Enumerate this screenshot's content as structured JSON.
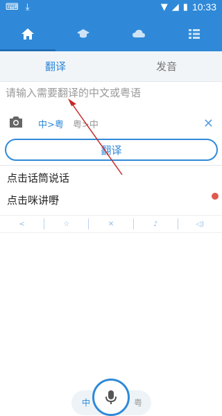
{
  "status_bar": {
    "time": "10:33",
    "icons": [
      "keyboard-icon",
      "download-icon",
      "wifi-icon",
      "signal-icon",
      "battery-icon"
    ]
  },
  "top_nav": {
    "items": [
      {
        "icon": "home-icon",
        "active": true
      },
      {
        "icon": "graduation-cap-icon",
        "active": false
      },
      {
        "icon": "cloud-icon",
        "active": false
      },
      {
        "icon": "grid-list-icon",
        "active": false
      }
    ]
  },
  "tabs": {
    "translate": "翻译",
    "pronounce": "发音"
  },
  "input": {
    "placeholder": "请输入需要翻译的中文或粤语"
  },
  "controls": {
    "camera_icon": "camera-icon",
    "zh_to_yue": "中>粤",
    "yue_to_zh": "粤>中",
    "clear_icon": "close-icon"
  },
  "translate_button": "翻译",
  "output": {
    "line1": "点击话筒说话",
    "line2": "点击咪讲嘢"
  },
  "actions": [
    {
      "icon": "share-icon",
      "glyph": "<"
    },
    {
      "icon": "star-icon",
      "glyph": "☆"
    },
    {
      "icon": "close-icon",
      "glyph": "✕"
    },
    {
      "icon": "person-voice-icon",
      "glyph": "♪"
    },
    {
      "icon": "speaker-icon",
      "glyph": "◁)"
    }
  ],
  "voice": {
    "left": "中",
    "right": "粤"
  },
  "colors": {
    "primary": "#2f89d8",
    "red_dot": "#e05a4f"
  }
}
